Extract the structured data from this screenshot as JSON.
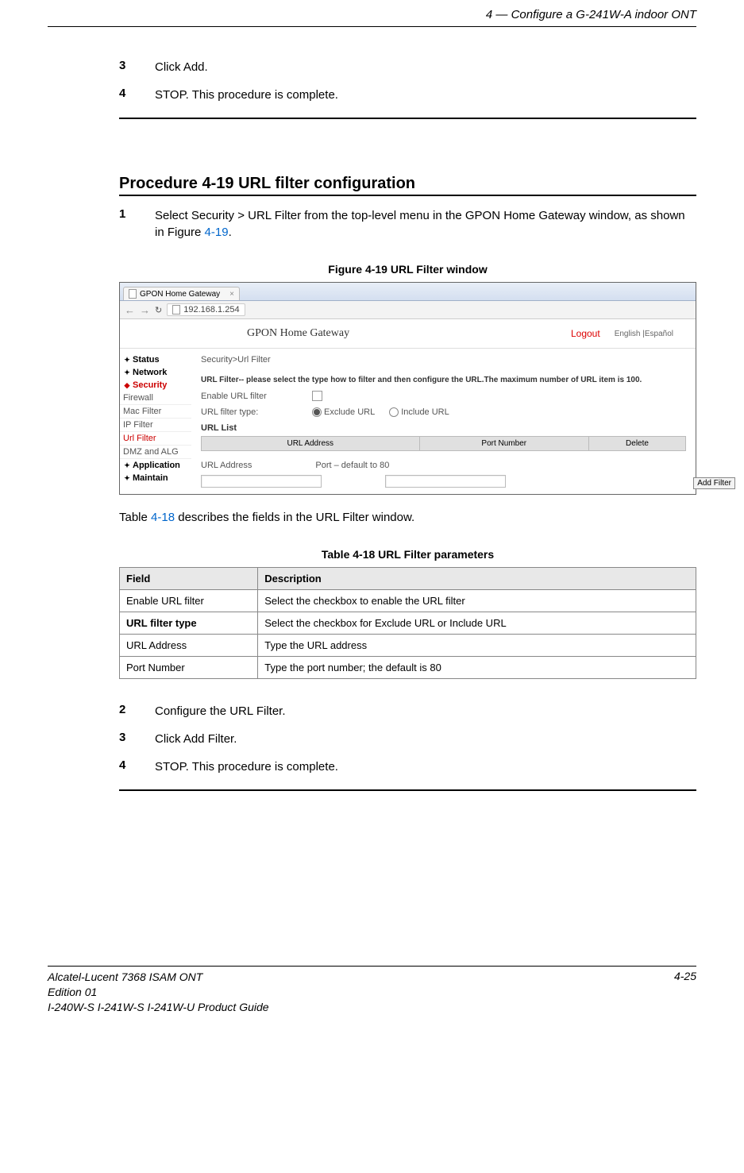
{
  "header": {
    "right_text": "4 —  Configure a G-241W-A indoor ONT"
  },
  "topSteps": [
    {
      "num": "3",
      "text": "Click Add."
    },
    {
      "num": "4",
      "text": "STOP. This procedure is complete."
    }
  ],
  "procedure": {
    "title": "Procedure 4-19  URL filter configuration",
    "step1": {
      "num": "1",
      "pre": "Select Security > URL Filter from the top-level menu in the GPON Home Gateway window, as shown in Figure ",
      "link": "4-19",
      "post": "."
    }
  },
  "figure": {
    "caption": "Figure 4-19  URL Filter window",
    "tab_title": "GPON Home Gateway",
    "url": "192.168.1.254",
    "app_title": "GPON Home Gateway",
    "logout": "Logout",
    "lang": "English |Español",
    "breadcrumb": "Security>Url Filter",
    "sidebar": {
      "status": "Status",
      "network": "Network",
      "security": "Security",
      "firewall": "Firewall",
      "macfilter": "Mac Filter",
      "ipfilter": "IP Filter",
      "urlfilter": "Url Filter",
      "dmz": "DMZ and ALG",
      "application": "Application",
      "maintain": "Maintain"
    },
    "instr": "URL Filter-- please select the type how to filter and then configure the URL.The maximum number of URL item is 100.",
    "enable_label": "Enable URL filter",
    "type_label": "URL filter type:",
    "type_exclude": "Exclude URL",
    "type_include": "Include URL",
    "list_label": "URL List",
    "th_url": "URL Address",
    "th_port": "Port Number",
    "th_delete": "Delete",
    "input_url_label": "URL Address",
    "input_port_label": "Port – default to 80",
    "add_filter": "Add Filter"
  },
  "tableIntro": {
    "pre": "Table ",
    "link": "4-18",
    "post": " describes the fields in the URL Filter window."
  },
  "table": {
    "caption": "Table 4-18 URL Filter parameters",
    "h1": "Field",
    "h2": "Description",
    "rows": [
      {
        "f": "Enable URL filter",
        "d": "Select the checkbox to enable the URL filter",
        "bold": false
      },
      {
        "f": "URL filter type",
        "d": "Select the checkbox for Exclude URL or Include URL",
        "bold": true
      },
      {
        "f": "URL Address",
        "d": "Type the URL address",
        "bold": false
      },
      {
        "f": "Port Number",
        "d": "Type the port number; the default is 80",
        "bold": false
      }
    ]
  },
  "bottomSteps": [
    {
      "num": "2",
      "text": "Configure the URL Filter."
    },
    {
      "num": "3",
      "text": "Click Add Filter."
    },
    {
      "num": "4",
      "text": "STOP. This procedure is complete."
    }
  ],
  "footer": {
    "l1": "Alcatel-Lucent 7368 ISAM ONT",
    "l2": "Edition 01",
    "l3": "I-240W-S I-241W-S I-241W-U Product Guide",
    "page": "4-25"
  }
}
